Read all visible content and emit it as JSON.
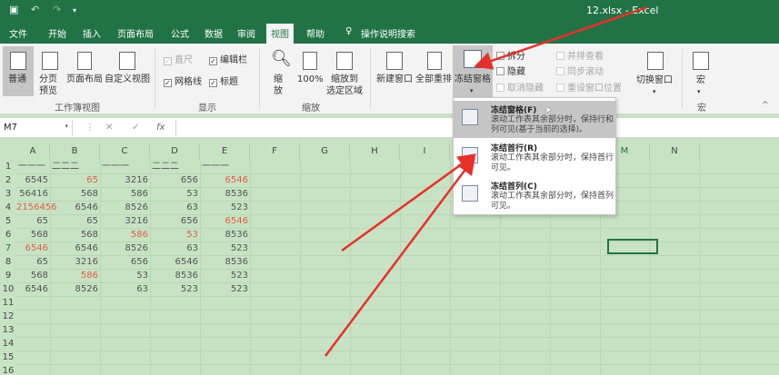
{
  "titlebar": {
    "title": "12.xlsx  -  Excel",
    "save_icon": "save-icon",
    "undo_icon": "undo-icon",
    "redo_icon": "redo-icon",
    "customize_icon": "customize-icon"
  },
  "tabs": [
    "文件",
    "开始",
    "插入",
    "页面布局",
    "公式",
    "数据",
    "审阅",
    "视图",
    "帮助",
    "操作说明搜索"
  ],
  "active_tab": "视图",
  "ribbon": {
    "workbook_view": {
      "normal": "普通",
      "page_break": "分页\n预览",
      "page_layout": "页面布局",
      "custom_view": "自定义视图",
      "group_label": "工作簿视图"
    },
    "show": {
      "ruler": "直尺",
      "formula_bar": "编辑栏",
      "gridlines": "网格线",
      "headings": "标题",
      "group_label": "显示"
    },
    "zoom": {
      "zoom": "缩\n放",
      "hundred": "100%",
      "zoom_to_selection": "缩放到\n选定区域",
      "group_label": "缩放"
    },
    "window": {
      "new_window": "新建窗口",
      "arrange_all": "全部重排",
      "freeze_panes": "冻结窗格",
      "split": "拆分",
      "hide": "隐藏",
      "unhide": "取消隐藏",
      "side_by_side": "并排查看",
      "sync_scroll": "同步滚动",
      "reset_position": "重设窗口位置",
      "switch_windows": "切换窗口",
      "group_label": "窗口"
    },
    "macros": {
      "macro": "宏",
      "group_label": "宏"
    }
  },
  "formula_bar": {
    "name_box": "M7",
    "cancel": "✕",
    "enter": "✓",
    "fx": "fx"
  },
  "columns": [
    "A",
    "B",
    "C",
    "D",
    "E",
    "F",
    "G",
    "H",
    "I",
    "J",
    "K",
    "L",
    "M",
    "N"
  ],
  "selected_column": "M",
  "selected_row": "7",
  "rows": [
    "1",
    "2",
    "3",
    "4",
    "5",
    "6",
    "7",
    "8",
    "9",
    "10",
    "11",
    "12",
    "13",
    "14",
    "15",
    "16"
  ],
  "row1_header_text": [
    "一一一",
    "二二二",
    "一一一",
    "二二二",
    "一一一"
  ],
  "cells": [
    {
      "row": 2,
      "values": [
        "6545",
        "65",
        "3216",
        "656",
        "6546"
      ],
      "red": [
        false,
        true,
        false,
        false,
        true
      ]
    },
    {
      "row": 3,
      "values": [
        "56416",
        "568",
        "586",
        "53",
        "8536"
      ],
      "red": [
        false,
        false,
        false,
        false,
        false
      ]
    },
    {
      "row": 4,
      "values": [
        "2156456",
        "6546",
        "8526",
        "63",
        "523"
      ],
      "red": [
        true,
        false,
        false,
        false,
        false
      ]
    },
    {
      "row": 5,
      "values": [
        "65",
        "65",
        "3216",
        "656",
        "6546"
      ],
      "red": [
        false,
        false,
        false,
        false,
        true
      ]
    },
    {
      "row": 6,
      "values": [
        "568",
        "568",
        "586",
        "53",
        "8536"
      ],
      "red": [
        false,
        false,
        true,
        true,
        false
      ]
    },
    {
      "row": 7,
      "values": [
        "6546",
        "6546",
        "8526",
        "63",
        "523"
      ],
      "red": [
        true,
        false,
        false,
        false,
        false
      ]
    },
    {
      "row": 8,
      "values": [
        "65",
        "3216",
        "656",
        "6546",
        "8536"
      ],
      "red": [
        false,
        false,
        false,
        false,
        false
      ]
    },
    {
      "row": 9,
      "values": [
        "568",
        "586",
        "53",
        "8536",
        "523"
      ],
      "red": [
        false,
        true,
        false,
        false,
        false
      ]
    },
    {
      "row": 10,
      "values": [
        "6546",
        "8526",
        "63",
        "523",
        "523"
      ],
      "red": [
        false,
        false,
        false,
        false,
        false
      ]
    }
  ],
  "dropdown": [
    {
      "title": "冻结窗格(F)",
      "desc": "滚动工作表其余部分时，保持行和列可见(基于当前的选择)。",
      "icon": "freeze-panes-icon"
    },
    {
      "title": "冻结首行(R)",
      "desc": "滚动工作表其余部分时，保持首行可见。",
      "icon": "freeze-top-row-icon"
    },
    {
      "title": "冻结首列(C)",
      "desc": "滚动工作表其余部分时，保持首列可见。",
      "icon": "freeze-first-column-icon"
    }
  ],
  "colors": {
    "excel_green": "#217346",
    "sheet_bg": "#c7e3c4",
    "red_value": "#e05d4a",
    "annotation_red": "#e8302a"
  }
}
